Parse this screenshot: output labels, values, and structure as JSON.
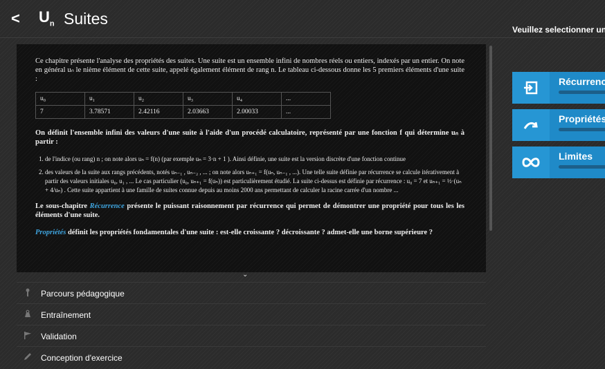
{
  "header": {
    "back_label": "<",
    "icon_text": "U",
    "icon_sub": "n",
    "title": "Suites",
    "select_prompt": "Veuillez selectionner un sc"
  },
  "content": {
    "intro": "Ce chapitre présente l'analyse des propriétés des suites. Une suite est un ensemble infini de nombres réels ou entiers, indexés par un entier. On note en général uₙ le nième élément de cette suite, appelé également élément de rang n. Le tableau ci-dessous donne les 5 premiers éléments d'une suite :",
    "table": {
      "headers": [
        "u₀",
        "u₁",
        "u₂",
        "u₃",
        "u₄",
        "..."
      ],
      "values": [
        "7",
        "3.78571",
        "2.42116",
        "2.03663",
        "2.00033",
        "..."
      ]
    },
    "defined": "On définit l'ensemble infini des valeurs d'une suite à l'aide d'un procédé calculatoire, représenté par une fonction f qui détermine uₙ à partir :",
    "list": [
      "de l'indice (ou rang) n ; on note alors uₙ = f(n) (par exemple uₙ = 3·n + 1 ). Ainsi définie, une suite est la version discrète d'une fonction continue",
      "des valeurs de la suite aux rangs précédents, notés uₙ₋₁ , uₙ₋₂ , ... ; on note alors uₙ₊₁ = f(uₙ, uₙ₋₁ , ...). Une telle suite définie par récurrence se calcule itérativement à partir des valeurs initiales u₀, u₁ , ... Le cas particulier (u₀, uₙ₊₁ = f(uₙ)) est particulièrement étudié. La suite ci-dessus est définie par récurrence : u₀ = 7 et uₙ₊₁ = ½·(uₙ + 4/uₙ) . Cette suite appartient à une famille de suites connue depuis au moins 2000 ans permettant de calculer la racine carrée d'un nombre ..."
    ],
    "recurrence_pre": "Le sous-chapitre ",
    "recurrence_link": "Récurrence",
    "recurrence_post": " présente le puissant raisonnement par récurrence qui permet de démontrer une propriété pour tous les les éléments d'une suite.",
    "proprietes_link": "Propriétés",
    "proprietes_post": " définit les propriétés fondamentales d'une suite : est-elle croissante ? décroissante ? admet-elle une borne supérieure ?",
    "scroll_more": "⌄"
  },
  "cards": [
    {
      "label": "Récurrence",
      "icon": "recurrence-icon",
      "progress": 0
    },
    {
      "label": "Propriétés",
      "icon": "trend-arrow-icon",
      "progress": 0
    },
    {
      "label": "Limites",
      "icon": "infinity-icon",
      "progress": 0
    }
  ],
  "menu": [
    {
      "label": "Parcours pédagogique",
      "icon": "pin-icon"
    },
    {
      "label": "Entraînement",
      "icon": "weight-icon"
    },
    {
      "label": "Validation",
      "icon": "flag-icon"
    },
    {
      "label": "Conception d'exercice",
      "icon": "pencil-icon"
    }
  ],
  "colors": {
    "accent": "#1f8ac8",
    "link": "#3fa5e0",
    "panel": "#111111",
    "background": "#2b2b2b"
  }
}
